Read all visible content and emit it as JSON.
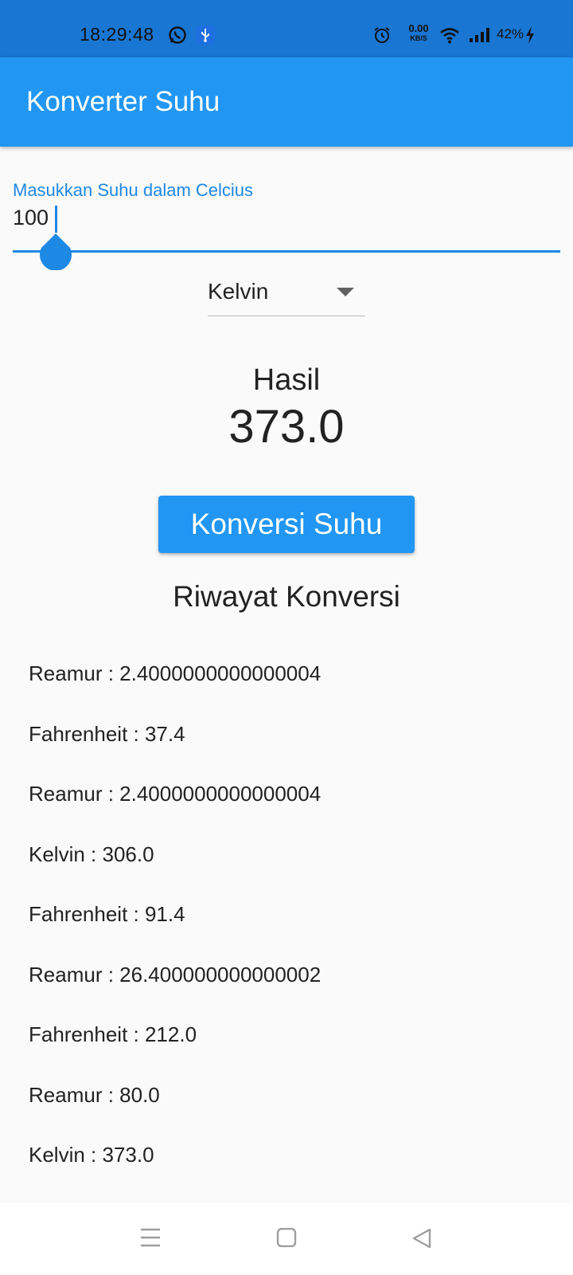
{
  "status_bar": {
    "time": "18:29:48",
    "net_speed_value": "0.00",
    "net_speed_unit": "KB/S",
    "battery": "42%",
    "icons": [
      "whatsapp-icon",
      "usb-icon",
      "alarm-icon",
      "wifi-icon",
      "signal-icon",
      "charging-icon"
    ]
  },
  "app_bar": {
    "title": "Konverter Suhu"
  },
  "input": {
    "label": "Masukkan Suhu dalam Celcius",
    "value": "100"
  },
  "dropdown": {
    "selected": "Kelvin"
  },
  "result": {
    "label": "Hasil",
    "value": "373.0"
  },
  "convert_button": {
    "label": "Konversi Suhu"
  },
  "history": {
    "title": "Riwayat Konversi",
    "items": [
      "Reamur : 2.4000000000000004",
      "Fahrenheit : 37.4",
      "Reamur : 2.4000000000000004",
      "Kelvin : 306.0",
      "Fahrenheit : 91.4",
      "Reamur : 26.400000000000002",
      "Fahrenheit : 212.0",
      "Reamur : 80.0",
      "Kelvin : 373.0"
    ]
  },
  "nav_bar": {
    "buttons": [
      "menu-icon",
      "home-icon",
      "back-icon"
    ]
  },
  "colors": {
    "status_bar": "#1976d2",
    "primary": "#2196f3",
    "accent": "#1e88e5",
    "background": "#fafafa"
  }
}
